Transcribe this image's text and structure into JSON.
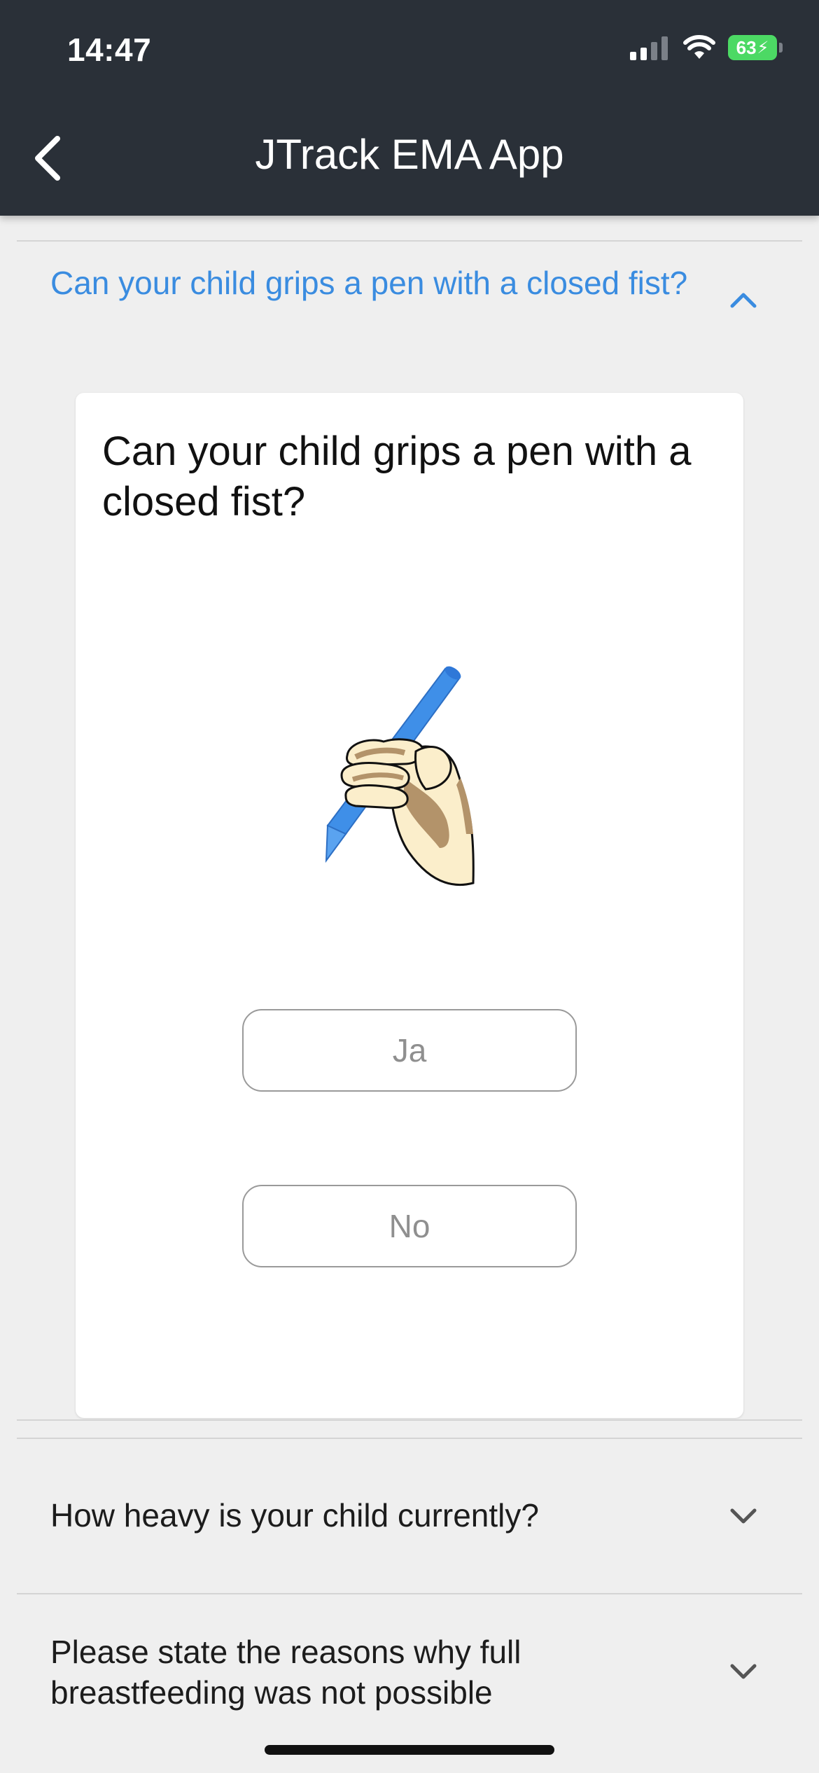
{
  "status_bar": {
    "time": "14:47",
    "battery_level": "63",
    "battery_color": "#4cd964",
    "icons": [
      "signal-icon",
      "wifi-icon",
      "battery-charging-icon"
    ]
  },
  "header": {
    "title": "JTrack EMA App",
    "back_icon": "chevron-left-icon",
    "background": "#2a3038"
  },
  "questions": [
    {
      "title": "Can your child grips a pen with a closed fist?",
      "expanded": true,
      "accent_color": "#3a8ce0",
      "card": {
        "question": "Can your child grips a pen with a closed fist?",
        "illustration": "fist-holding-pen-illustration",
        "options": [
          "Ja",
          "No"
        ]
      }
    },
    {
      "title": "How heavy is your child currently?",
      "expanded": false
    },
    {
      "title": "Please state the reasons why full breastfeeding was not possible",
      "expanded": false
    }
  ]
}
